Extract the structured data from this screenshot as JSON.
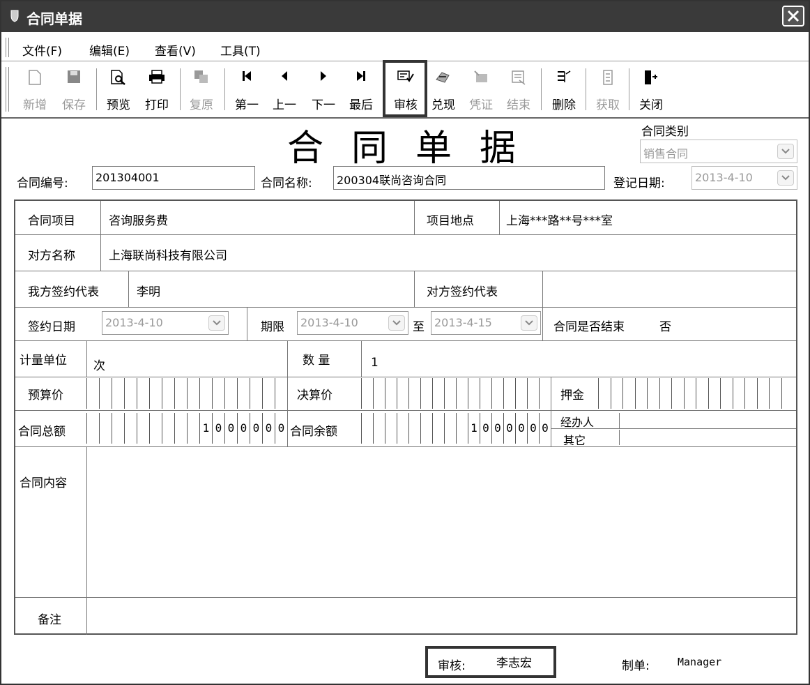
{
  "window": {
    "title": "合同单据"
  },
  "menu": [
    "文件(F)",
    "编辑(E)",
    "查看(V)",
    "工具(T)"
  ],
  "toolbar": {
    "new": "新增",
    "save": "保存",
    "preview": "预览",
    "print": "打印",
    "restore": "复原",
    "first": "第一",
    "prev": "上一",
    "next": "下一",
    "last": "最后",
    "audit": "审核",
    "redeem": "兑现",
    "voucher": "凭证",
    "finish": "结束",
    "delete": "删除",
    "fetch": "获取",
    "close": "关闭"
  },
  "header": {
    "title": "合同单据",
    "category_label": "合同类别",
    "category_value": "销售合同",
    "contract_no_label": "合同编号:",
    "contract_no": "201304001",
    "contract_name_label": "合同名称:",
    "contract_name": "200304联尚咨询合同",
    "reg_date_label": "登记日期:",
    "reg_date": "2013-4-10"
  },
  "form": {
    "project_label": "合同项目",
    "project": "咨询服务费",
    "location_label": "项目地点",
    "location": "上海***路**号***室",
    "party_label": "对方名称",
    "party": "上海联尚科技有限公司",
    "our_rep_label": "我方签约代表",
    "our_rep": "李明",
    "their_rep_label": "对方签约代表",
    "their_rep": "",
    "sign_date_label": "签约日期",
    "sign_date": "2013-4-10",
    "period_label": "期限",
    "period_start": "2013-4-10",
    "to_label": "至",
    "period_end": "2013-4-15",
    "finished_label": "合同是否结束",
    "finished": "否",
    "unit_label": "计量单位",
    "unit": "次",
    "qty_label": "数 量",
    "qty": "1",
    "budget_label": "预算价",
    "settle_label": "决算价",
    "deposit_label": "押金",
    "total_label": "合同总额",
    "total_digits": [
      "1",
      "0",
      "0",
      "0",
      "0",
      "0",
      "0"
    ],
    "balance_label": "合同余额",
    "balance_digits": [
      "1",
      "0",
      "0",
      "0",
      "0",
      "0",
      "0"
    ],
    "handler_label": "经办人",
    "other_label": "其它",
    "content_label": "合同内容",
    "remark_label": "备注"
  },
  "footer": {
    "audit_label": "审核:",
    "auditor": "李志宏",
    "maker_label": "制单:",
    "maker": "Manager"
  }
}
